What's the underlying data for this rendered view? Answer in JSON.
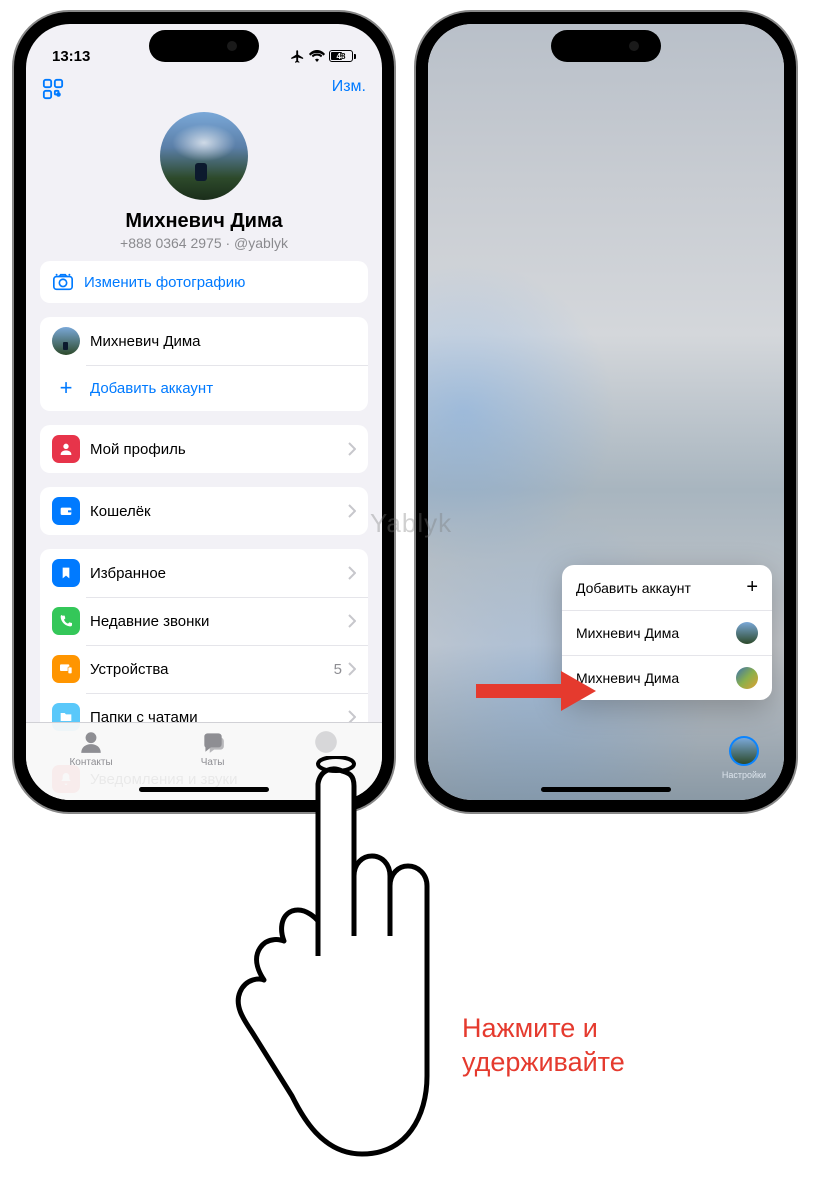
{
  "status": {
    "time": "13:13",
    "battery": "48"
  },
  "header": {
    "edit": "Изм."
  },
  "profile": {
    "name": "Михневич Дима",
    "sub": "+888 0364 2975 · @yablyk"
  },
  "rows": {
    "change_photo": "Изменить фотографию",
    "account_name": "Михневич Дима",
    "add_account": "Добавить аккаунт",
    "my_profile": "Мой профиль",
    "wallet": "Кошелёк",
    "favorites": "Избранное",
    "recent_calls": "Недавние звонки",
    "devices": "Устройства",
    "devices_count": "5",
    "chat_folders": "Папки с чатами",
    "notifications": "Уведомления и звуки"
  },
  "tabs": {
    "contacts": "Контакты",
    "chats": "Чаты",
    "settings": "Настройки"
  },
  "context_menu": {
    "add": "Добавить аккаунт",
    "acc1": "Михневич Дима",
    "acc2": "Михневич Дима"
  },
  "instruction": {
    "line1": "Нажмите и",
    "line2": "удерживайте"
  },
  "watermark": "Yablyk"
}
